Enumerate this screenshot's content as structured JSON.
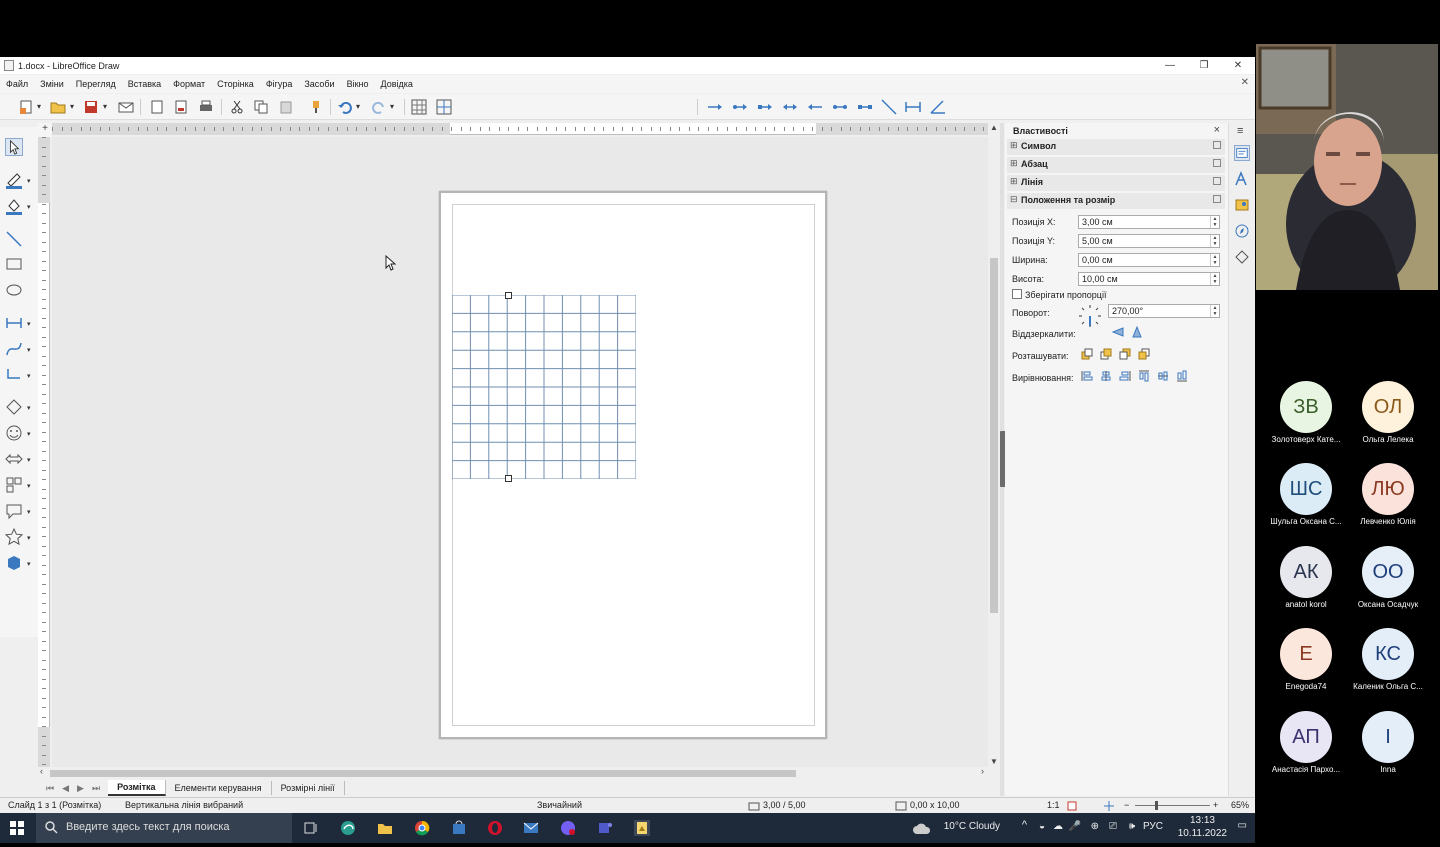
{
  "window": {
    "title": "1.docx - LibreOffice Draw",
    "controls": {
      "minimize": "—",
      "maximize": "❐",
      "close": "✕"
    }
  },
  "menu": {
    "items": [
      "Файл",
      "Зміни",
      "Перегляд",
      "Вставка",
      "Формат",
      "Сторінка",
      "Фігура",
      "Засоби",
      "Вікно",
      "Довідка"
    ],
    "close": "✕"
  },
  "ruler_corner": "+",
  "canvas": {
    "grid": {
      "columns": 10,
      "rows": 10,
      "line_color": "#6f8fb0"
    }
  },
  "tabs": {
    "nav": [
      "⏮",
      "◀",
      "▶",
      "⏭"
    ],
    "items": [
      {
        "label": "Розмітка",
        "active": true
      },
      {
        "label": "Елементи керування",
        "active": false
      },
      {
        "label": "Розмірні лінії",
        "active": false
      }
    ]
  },
  "statusbar": {
    "slide": "Слайд 1 з 1 (Розмітка)",
    "selection": "Вертикальна лінія вибраний",
    "style": "Звичайний",
    "position": "3,00 / 5,00",
    "size": "0,00 x 10,00",
    "scale": "1:1",
    "zoom": "65%"
  },
  "sidebar": {
    "title": "Властивості",
    "sections": [
      {
        "label": "Символ",
        "expanded": false
      },
      {
        "label": "Абзац",
        "expanded": false
      },
      {
        "label": "Лінія",
        "expanded": false
      },
      {
        "label": "Положення та розмір",
        "expanded": true
      }
    ],
    "fields": {
      "pos_x": {
        "label": "Позиція X:",
        "value": "3,00 см"
      },
      "pos_y": {
        "label": "Позиція Y:",
        "value": "5,00 см"
      },
      "width": {
        "label": "Ширина:",
        "value": "0,00 см"
      },
      "height": {
        "label": "Висота:",
        "value": "10,00 см"
      },
      "keep_ratio": {
        "label": "Зберігати пропорції",
        "checked": false
      },
      "rotation": {
        "label": "Поворот:",
        "value": "270,00°"
      },
      "flip": {
        "label": "Віддзеркалити:"
      },
      "arrange": {
        "label": "Розташувати:"
      },
      "align": {
        "label": "Вирівнювання:"
      }
    }
  },
  "taskbar": {
    "search_placeholder": "Введите здесь текст для поиска",
    "weather": "10°C  Cloudy",
    "language": "РУС",
    "time": "13:13",
    "date": "10.11.2022"
  },
  "participants": [
    {
      "initials": "ЗВ",
      "name": "Золотоверх Кате...",
      "bg": "#e8f5e3",
      "fg": "#3b5e2a"
    },
    {
      "initials": "ОЛ",
      "name": "Ольга Лелека",
      "bg": "#fff2dc",
      "fg": "#8a5a1a"
    },
    {
      "initials": "ШС",
      "name": "Шульга Оксана С...",
      "bg": "#dcecf7",
      "fg": "#1f4e7a"
    },
    {
      "initials": "ЛЮ",
      "name": "Левченко Юлія",
      "bg": "#fbe3dc",
      "fg": "#8a3a22"
    },
    {
      "initials": "АК",
      "name": "anatol korol",
      "bg": "#e6e8ee",
      "fg": "#2c3550"
    },
    {
      "initials": "ОО",
      "name": "Оксана Осадчук",
      "bg": "#e6eef8",
      "fg": "#1f3f7a"
    },
    {
      "initials": "Е",
      "name": "Enegoda74",
      "bg": "#fbe7dc",
      "fg": "#8a3a22"
    },
    {
      "initials": "КС",
      "name": "Каленик Ольга С...",
      "bg": "#e3eef8",
      "fg": "#1f3f7a"
    },
    {
      "initials": "АП",
      "name": "Анастасія Пархо...",
      "bg": "#e8e6f4",
      "fg": "#3c3270"
    },
    {
      "initials": "І",
      "name": "Inna",
      "bg": "#e3eef8",
      "fg": "#1f3f7a"
    }
  ]
}
